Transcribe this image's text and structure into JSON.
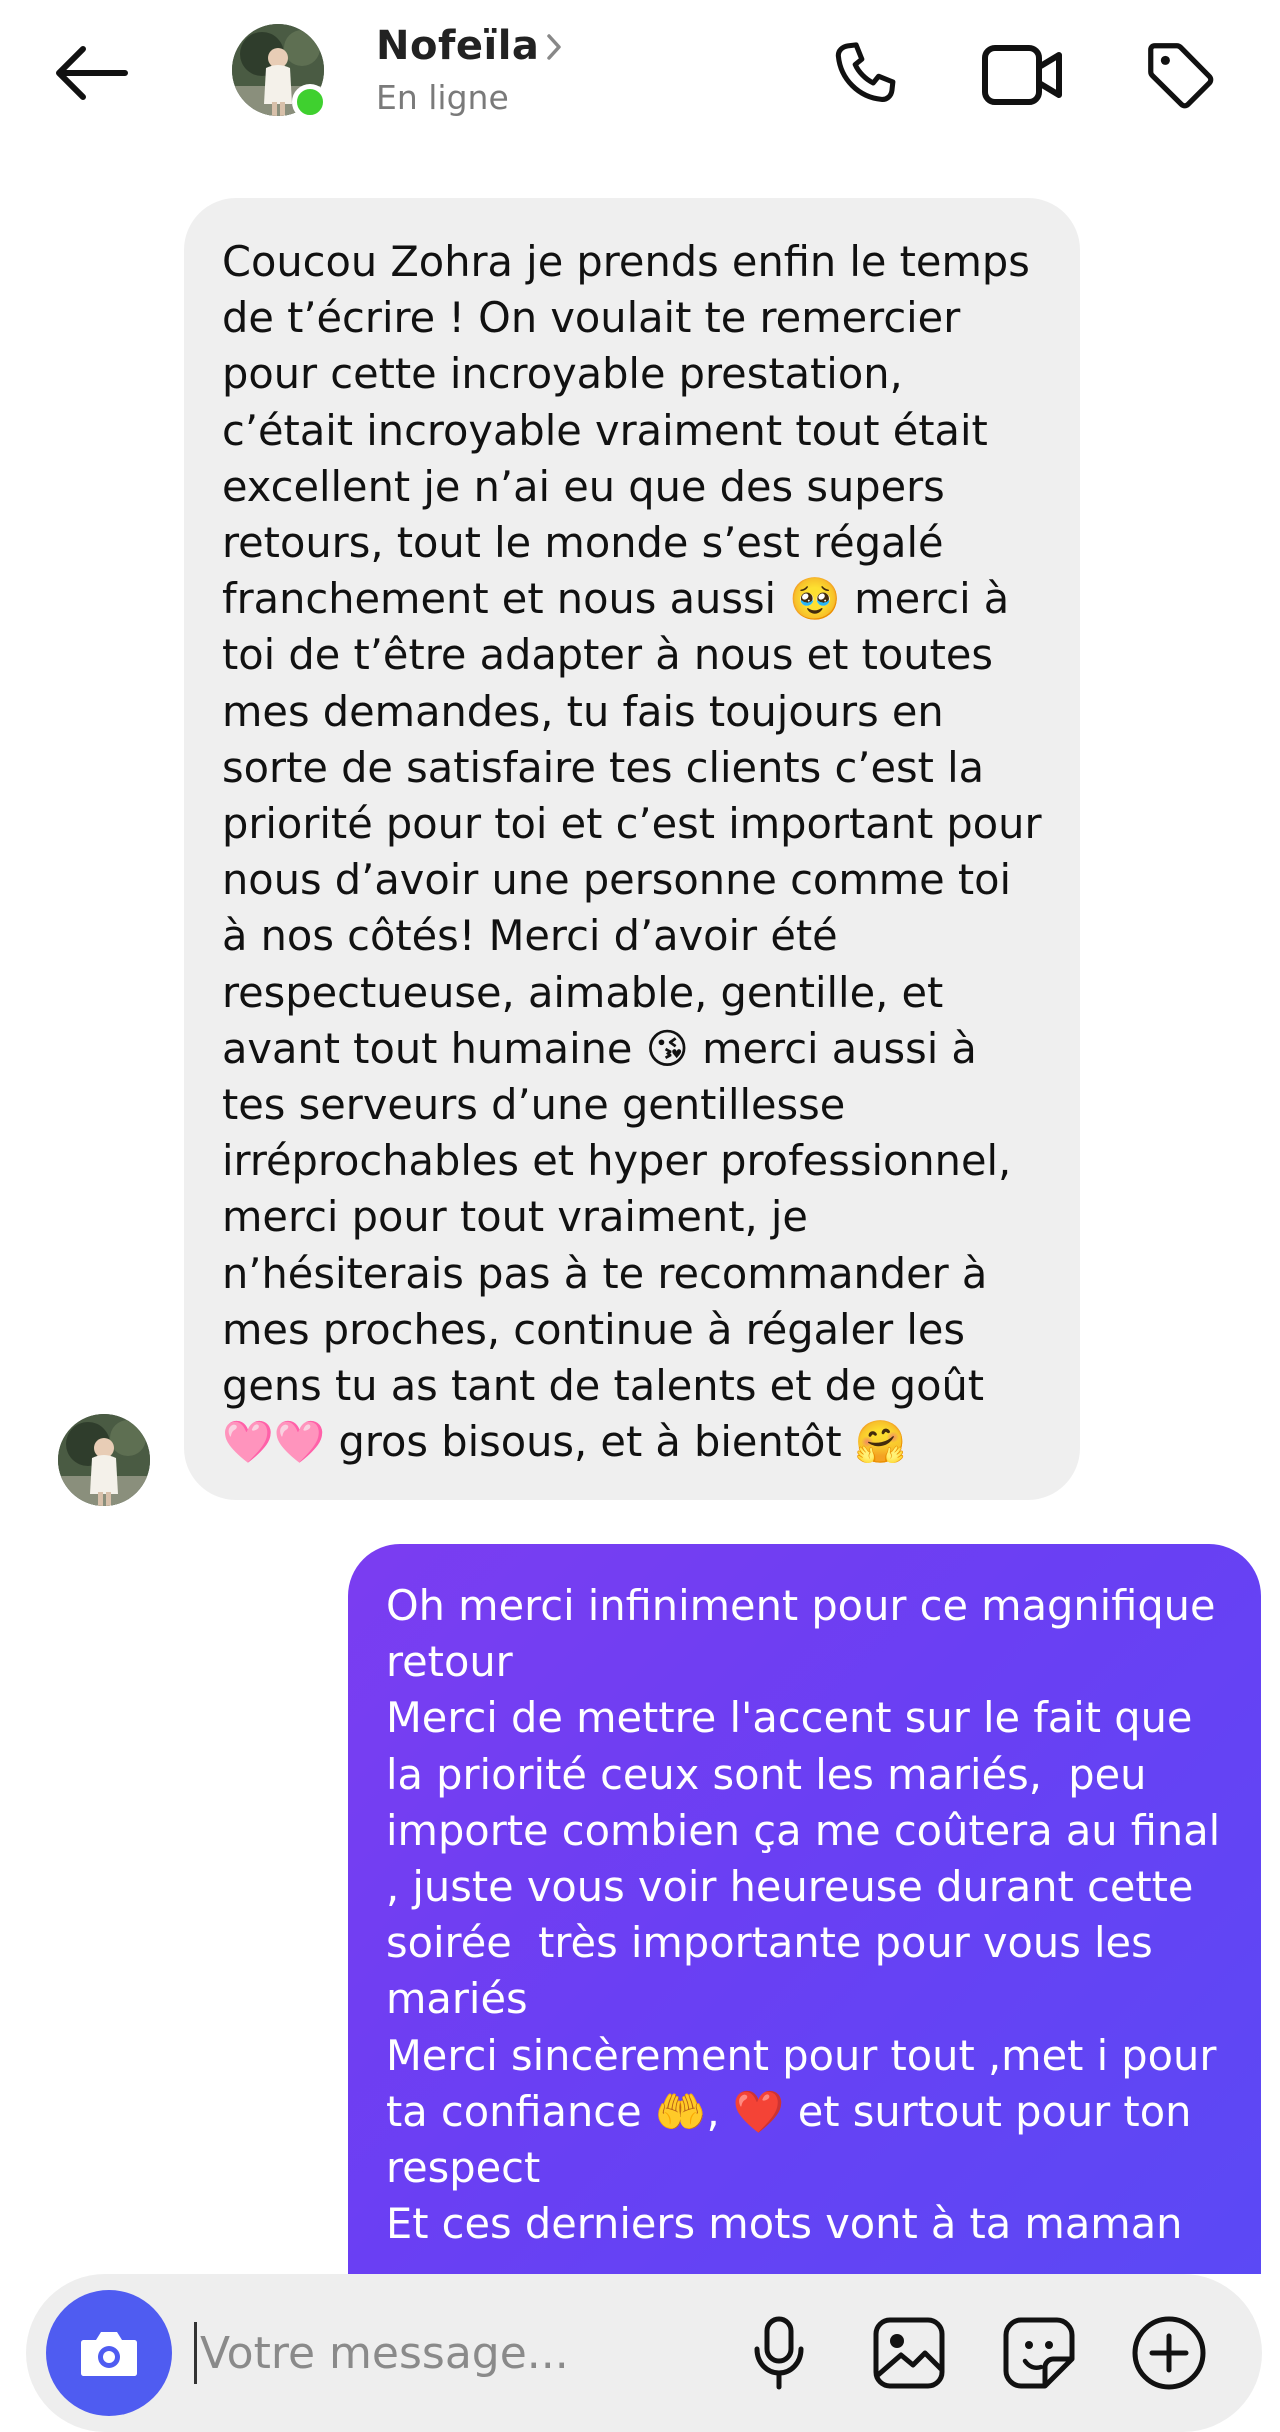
{
  "header": {
    "contact_name": "Nofeïla",
    "status": "En ligne",
    "icons": [
      "back-arrow-icon",
      "chevron-right-icon",
      "phone-icon",
      "video-camera-icon",
      "tag-icon"
    ]
  },
  "messages": [
    {
      "direction": "incoming",
      "text": "Coucou Zohra je prends enfin le temps de t’écrire ! On voulait te remercier pour cette incroyable prestation, c’était incroyable vraiment tout était excellent je n’ai eu que des supers retours, tout le monde s’est régalé franchement et nous aussi 🥹 merci à toi de t’être adapter à nous et toutes mes demandes, tu fais toujours en sorte de satisfaire tes clients c’est la priorité pour toi et c’est important pour nous d’avoir une personne comme toi à nos côtés! Merci d’avoir été respectueuse, aimable, gentille, et avant tout humaine 😘 merci aussi à tes serveurs d’une gentillesse irréprochables et hyper professionnel, merci pour tout vraiment, je n’hésiterais pas à te recommander à mes proches, continue à régaler les gens tu as tant de talents et de goût 🩷🩷 gros bisous, et à bientôt 🤗"
    },
    {
      "direction": "outgoing",
      "text": "Oh merci infiniment pour ce magnifique retour\nMerci de mettre l'accent sur le fait que la priorité ceux sont les mariés,  peu importe combien ça me coûtera au final , juste vous voir heureuse durant cette soirée  très importante pour vous les mariés\nMerci sincèrement pour tout ,met i pour ta confiance 🤲, ❤️ et surtout pour ton respect\nEt ces derniers mots vont à ta maman"
    }
  ],
  "composer": {
    "placeholder": "Votre message...",
    "icons": [
      "camera-icon",
      "microphone-icon",
      "gallery-icon",
      "sticker-icon",
      "plus-circle-icon"
    ]
  },
  "colors": {
    "incoming_bubble": "#efefef",
    "outgoing_gradient_start": "#7b3df1",
    "outgoing_gradient_end": "#5b49f5",
    "online_dot": "#3fd02f",
    "camera_button": "#4f5cf1"
  }
}
